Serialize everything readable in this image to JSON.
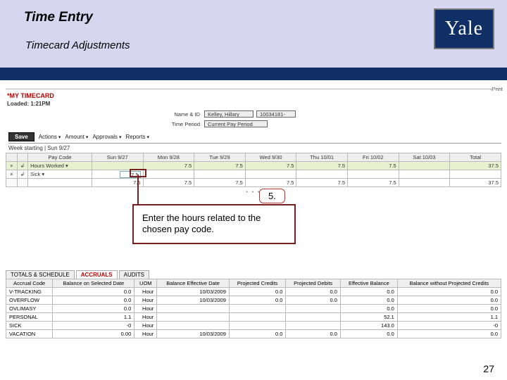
{
  "header": {
    "title": "Time Entry",
    "subtitle": "Timecard Adjustments",
    "logo_text": "Yale"
  },
  "print_link": "Print",
  "page": {
    "title": "*MY TIMECARD",
    "loaded": "Loaded: 1:21PM"
  },
  "form": {
    "name_label": "Name & ID",
    "name_value": "Kelley, Hillary",
    "id_value": "10034181-",
    "period_label": "Time Period",
    "period_value": "Current Pay Period"
  },
  "toolbar": {
    "save": "Save",
    "menus": [
      "Actions",
      "Amount",
      "Approvals",
      "Reports"
    ]
  },
  "timecard": {
    "week_label": "Week starting | Sun 9/27",
    "columns": [
      "Pay Code",
      "Sun 9/27",
      "Mon 9/28",
      "Tue 9/29",
      "Wed 9/30",
      "Thu 10/01",
      "Fri 10/02",
      "Sat 10/03",
      "Total"
    ],
    "rows": [
      {
        "ctrl_x": "×",
        "ctrl_e": "↲",
        "paycode": "Hours Worked",
        "dd": "▾",
        "cells": [
          "",
          "7.5",
          "7.5",
          "7.5",
          "7.5",
          "7.5",
          "",
          "37.5"
        ],
        "hl": true
      },
      {
        "ctrl_x": "×",
        "ctrl_e": "↲",
        "paycode": "Sick",
        "dd": "▾",
        "cells": [
          "7.5",
          "",
          "",
          "",
          "",
          "",
          "",
          ""
        ],
        "hl": false,
        "input_col": 0
      }
    ],
    "totals": [
      "",
      "7.5",
      "7.5",
      "7.5",
      "7.5",
      "7.5",
      "7.5",
      "",
      "37.5"
    ]
  },
  "callout": {
    "step": "5.",
    "text": "Enter the hours related to the chosen pay code."
  },
  "tabs": {
    "items": [
      "TOTALS & SCHEDULE",
      "ACCRUALS",
      "AUDITS"
    ],
    "active": 1
  },
  "accruals": {
    "headers": [
      "Accrual Code",
      "Balance on Selected Date",
      "UOM",
      "Balance Effective Date",
      "Projected Credits",
      "Projected Debits",
      "Effective Balance",
      "Balance without Projected Credits"
    ],
    "rows": [
      [
        "V-TRACKING",
        "0.0",
        "Hour",
        "10/03/2009",
        "0.0",
        "0.0",
        "0.0",
        "0.0"
      ],
      [
        "OVERFLOW",
        "0.0",
        "Hour",
        "10/03/2009",
        "0.0",
        "0.0",
        "0.0",
        "0.0"
      ],
      [
        "OVLIMASY",
        "0.0",
        "Hour",
        "",
        "",
        "",
        "0.0",
        "0.0"
      ],
      [
        "PERSONAL",
        "1.1",
        "Hour",
        "",
        "",
        "",
        "52.1",
        "1.1"
      ],
      [
        "SICK",
        "-0",
        "Hour",
        "",
        "",
        "",
        "143.0",
        "-0"
      ],
      [
        "VACATION",
        "0.00",
        "Hour",
        "10/03/2009",
        "0.0",
        "0.0",
        "0.0",
        "0.0"
      ]
    ]
  },
  "page_number": "27"
}
